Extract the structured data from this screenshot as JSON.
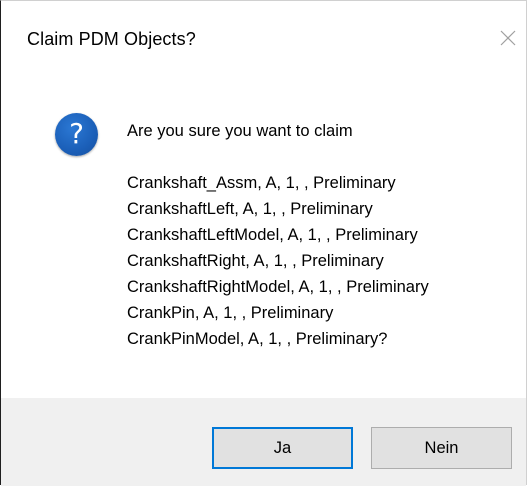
{
  "dialog": {
    "title": "Claim PDM Objects?",
    "icon": "question-icon",
    "icon_glyph": "?",
    "icon_color": "#1b5fb8",
    "message_intro": "Are you sure you want to claim",
    "items": [
      "Crankshaft_Assm, A, 1, , Preliminary",
      "CrankshaftLeft, A, 1, , Preliminary",
      "CrankshaftLeftModel, A, 1, , Preliminary",
      "CrankshaftRight, A, 1, , Preliminary",
      "CrankshaftRightModel, A, 1, , Preliminary",
      "CrankPin, A, 1, , Preliminary",
      "CrankPinModel, A, 1, , Preliminary?"
    ],
    "buttons": {
      "yes_label": "Ja",
      "no_label": "Nein"
    },
    "accent_color": "#0078d7"
  }
}
